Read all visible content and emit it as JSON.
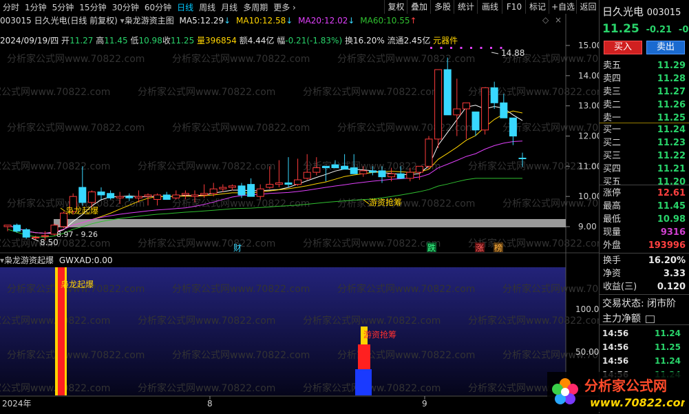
{
  "periods": [
    "分时",
    "1分钟",
    "5分钟",
    "15分钟",
    "30分钟",
    "60分钟",
    "日线",
    "周线",
    "月线",
    "多周期",
    "更多"
  ],
  "active_period": "日线",
  "toolbar": [
    "复权",
    "叠加",
    "多股",
    "统计",
    "画线",
    "F10",
    "标记",
    "+自选",
    "返回"
  ],
  "title": {
    "code": "003015",
    "name": "日久光电",
    "mode": "(日线 前复权)",
    "indicator": "枭龙游资主图",
    "ma5_label": "MA5:",
    "ma5": "12.29",
    "ma10_label": "MA10:",
    "ma10": "12.58",
    "ma20_label": "MA20:",
    "ma20": "12.02",
    "ma60_label": "MA60:",
    "ma60": "10.55"
  },
  "info": {
    "date": "2024/09/19/四",
    "open_label": "开",
    "open": "11.27",
    "high_label": "高",
    "high": "11.45",
    "low_label": "低",
    "low": "10.98",
    "close_label": "收",
    "close": "11.25",
    "vol_label": "量",
    "vol": "396854",
    "amount_label": "额",
    "amount": "4.44亿",
    "chg_label": "幅",
    "chg": "-0.21(-1.83%)",
    "turnover_label": "换",
    "turnover": "16.20%",
    "float_label": "流通",
    "float": "2.45亿",
    "element": "元器件"
  },
  "watermark": "分析家公式网www.70822.com",
  "chart_data": {
    "type": "candlestick",
    "x": [
      "d1",
      "d2",
      "d3",
      "d4",
      "d5",
      "d6",
      "d7",
      "d8",
      "d9",
      "d10",
      "d11",
      "d12",
      "d13",
      "d14",
      "d15",
      "d16",
      "d17",
      "d18",
      "d19",
      "d20",
      "d21",
      "d22",
      "d23",
      "d24",
      "d25",
      "d26",
      "d27",
      "d28",
      "d29",
      "d30",
      "d31",
      "d32",
      "d33",
      "d34",
      "d35",
      "d36",
      "d37",
      "d38",
      "d39",
      "d40",
      "d41",
      "d42",
      "d43",
      "d44",
      "d45",
      "d46",
      "d47",
      "d48",
      "d49",
      "d50",
      "d51",
      "d52",
      "d53",
      "d54",
      "d55",
      "d56"
    ],
    "open": [
      9.0,
      9.05,
      8.9,
      8.65,
      8.7,
      8.75,
      9.0,
      9.5,
      10.3,
      9.8,
      10.15,
      10.1,
      9.95,
      10.0,
      9.95,
      10.0,
      9.9,
      10.05,
      9.95,
      10.05,
      10.0,
      10.05,
      10.1,
      10.25,
      10.3,
      10.35,
      10.4,
      10.0,
      10.3,
      10.4,
      10.45,
      10.4,
      10.6,
      10.8,
      11.0,
      11.05,
      11.0,
      10.95,
      10.75,
      10.85,
      10.85,
      10.65,
      10.75,
      10.6,
      10.8,
      11.0,
      11.9,
      14.2,
      12.7,
      12.9,
      12.8,
      12.2,
      13.6,
      13.1,
      12.6,
      11.27
    ],
    "high": [
      9.05,
      9.1,
      8.95,
      8.7,
      8.85,
      9.1,
      9.5,
      10.1,
      11.0,
      10.2,
      10.3,
      10.2,
      10.15,
      10.1,
      10.2,
      10.1,
      10.1,
      10.15,
      10.2,
      10.2,
      10.2,
      10.4,
      10.45,
      10.4,
      10.4,
      10.45,
      10.6,
      10.4,
      11.0,
      11.2,
      11.3,
      11.25,
      11.4,
      11.3,
      11.0,
      11.2,
      11.4,
      11.4,
      11.0,
      11.0,
      11.0,
      10.95,
      11.0,
      10.95,
      11.0,
      12.0,
      12.8,
      14.6,
      13.9,
      12.9,
      12.8,
      12.6,
      13.8,
      13.4,
      12.6,
      11.45
    ],
    "low": [
      8.85,
      8.8,
      8.6,
      8.55,
      8.55,
      8.7,
      8.95,
      9.4,
      9.7,
      9.6,
      9.9,
      9.9,
      9.75,
      9.85,
      9.8,
      9.7,
      9.7,
      9.9,
      9.9,
      9.9,
      9.8,
      9.95,
      10.0,
      10.15,
      10.2,
      9.95,
      10.0,
      9.9,
      10.25,
      10.3,
      10.3,
      10.35,
      10.55,
      10.7,
      10.5,
      11.0,
      10.9,
      10.8,
      10.65,
      10.7,
      10.45,
      10.5,
      10.6,
      10.5,
      10.55,
      10.9,
      11.6,
      12.7,
      12.0,
      11.9,
      12.0,
      12.05,
      12.9,
      12.6,
      11.7,
      10.98
    ],
    "close": [
      9.05,
      8.85,
      8.65,
      8.65,
      8.7,
      9.05,
      9.45,
      10.0,
      9.8,
      10.15,
      10.05,
      9.95,
      10.0,
      9.95,
      10.0,
      10.05,
      10.05,
      9.9,
      10.05,
      10.1,
      10.05,
      10.1,
      10.25,
      10.3,
      10.35,
      10.05,
      10.0,
      10.25,
      10.4,
      10.45,
      10.4,
      10.55,
      10.8,
      10.95,
      10.95,
      10.95,
      10.9,
      10.75,
      10.85,
      10.8,
      10.65,
      10.75,
      10.6,
      10.8,
      11.0,
      11.9,
      14.2,
      12.7,
      12.9,
      13.1,
      12.2,
      13.6,
      13.1,
      12.6,
      12.0,
      11.25
    ],
    "ylim": [
      8.4,
      15.2
    ],
    "y_ticks": [
      "15.00",
      "14.00",
      "13.00",
      "12.00",
      "11.00",
      "10.00",
      "9.00"
    ],
    "annotations": [
      "枭龙起爆",
      "游资抢筹",
      "14.88",
      "8.50",
      "8.97 - 9.26"
    ],
    "markers": [
      "财",
      "跌",
      "涨",
      "榜"
    ],
    "x_labels": [
      "2024年",
      "8",
      "9"
    ]
  },
  "sub": {
    "name": "枭龙游资起爆",
    "gwxad_label": "GWXAD:",
    "gwxad": "0.00",
    "y_ticks": [
      "100.0",
      "50.00"
    ],
    "signal1": "枭龙起爆",
    "signal2": "游资抢筹"
  },
  "quote": {
    "name": "日久光电",
    "code": "003015",
    "price": "11.25",
    "change": "-0.21",
    "change_pct": "-0.0",
    "buy_button": "买入",
    "sell_button": "卖出",
    "asks": [
      {
        "label": "卖五",
        "price": "11.29"
      },
      {
        "label": "卖四",
        "price": "11.28"
      },
      {
        "label": "卖三",
        "price": "11.27"
      },
      {
        "label": "卖二",
        "price": "11.26"
      },
      {
        "label": "卖一",
        "price": "11.25"
      }
    ],
    "bids": [
      {
        "label": "买一",
        "price": "11.24"
      },
      {
        "label": "买二",
        "price": "11.23"
      },
      {
        "label": "买三",
        "price": "11.22"
      },
      {
        "label": "买四",
        "price": "11.21"
      },
      {
        "label": "买五",
        "price": "11.20"
      }
    ],
    "stats": [
      {
        "label": "涨停",
        "value": "12.61",
        "color": "#ff4040"
      },
      {
        "label": "最高",
        "value": "11.45",
        "color": "#29d36a"
      },
      {
        "label": "最低",
        "value": "10.98",
        "color": "#29d36a"
      },
      {
        "label": "现量",
        "value": "9316",
        "color": "#d040d0"
      },
      {
        "label": "外盘",
        "value": "193996",
        "color": "#ff4040"
      }
    ],
    "stats2": [
      {
        "label": "换手",
        "value": "16.20%"
      },
      {
        "label": "净资",
        "value": "3.33"
      },
      {
        "label": "收益(三)",
        "value": "0.120"
      }
    ],
    "trade_status": "交易状态: 闭市阶",
    "net_flow": "主力净额",
    "ticks": [
      {
        "time": "14:56",
        "price": "11.24"
      },
      {
        "time": "14:56",
        "price": "11.25"
      },
      {
        "time": "14:56",
        "price": "11.24"
      },
      {
        "time": "14:56",
        "price": "11.24"
      }
    ]
  },
  "logo": {
    "text": "分析家公式网",
    "url": "www.70822.com"
  },
  "colors": {
    "up": "#ff3b3b",
    "down": "#38d8ff",
    "ma5": "#ffffff",
    "ma10": "#ffd400",
    "ma20": "#e040fb",
    "ma60": "#30c030"
  }
}
